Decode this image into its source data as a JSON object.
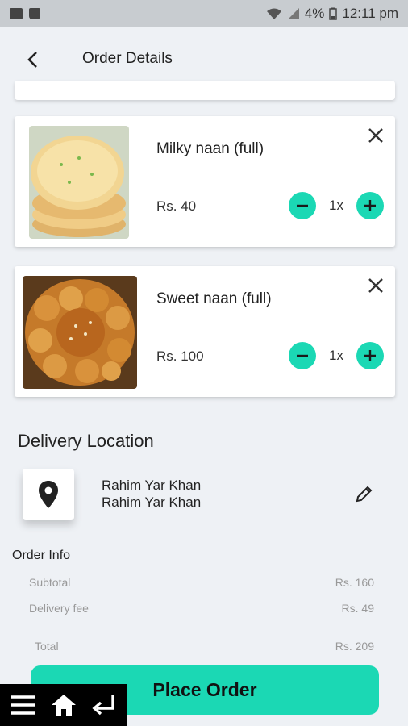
{
  "status": {
    "battery": "4%",
    "time": "12:11 pm"
  },
  "header": {
    "title": "Order Details"
  },
  "items": [
    {
      "name": "Milky naan (full)",
      "price": "Rs. 40",
      "qty": "1x"
    },
    {
      "name": "Sweet naan (full)",
      "price": "Rs. 100",
      "qty": "1x"
    }
  ],
  "delivery": {
    "title": "Delivery Location",
    "line1": "Rahim Yar Khan",
    "line2": "Rahim Yar Khan"
  },
  "order_info": {
    "title": "Order Info",
    "subtotal_label": "Subtotal",
    "subtotal_value": "Rs. 160",
    "delivery_label": "Delivery fee",
    "delivery_value": "Rs. 49",
    "total_label": "Total",
    "total_value": "Rs. 209"
  },
  "actions": {
    "place_order": "Place Order"
  },
  "colors": {
    "accent": "#1bd8b4",
    "background": "#eef1f5"
  }
}
